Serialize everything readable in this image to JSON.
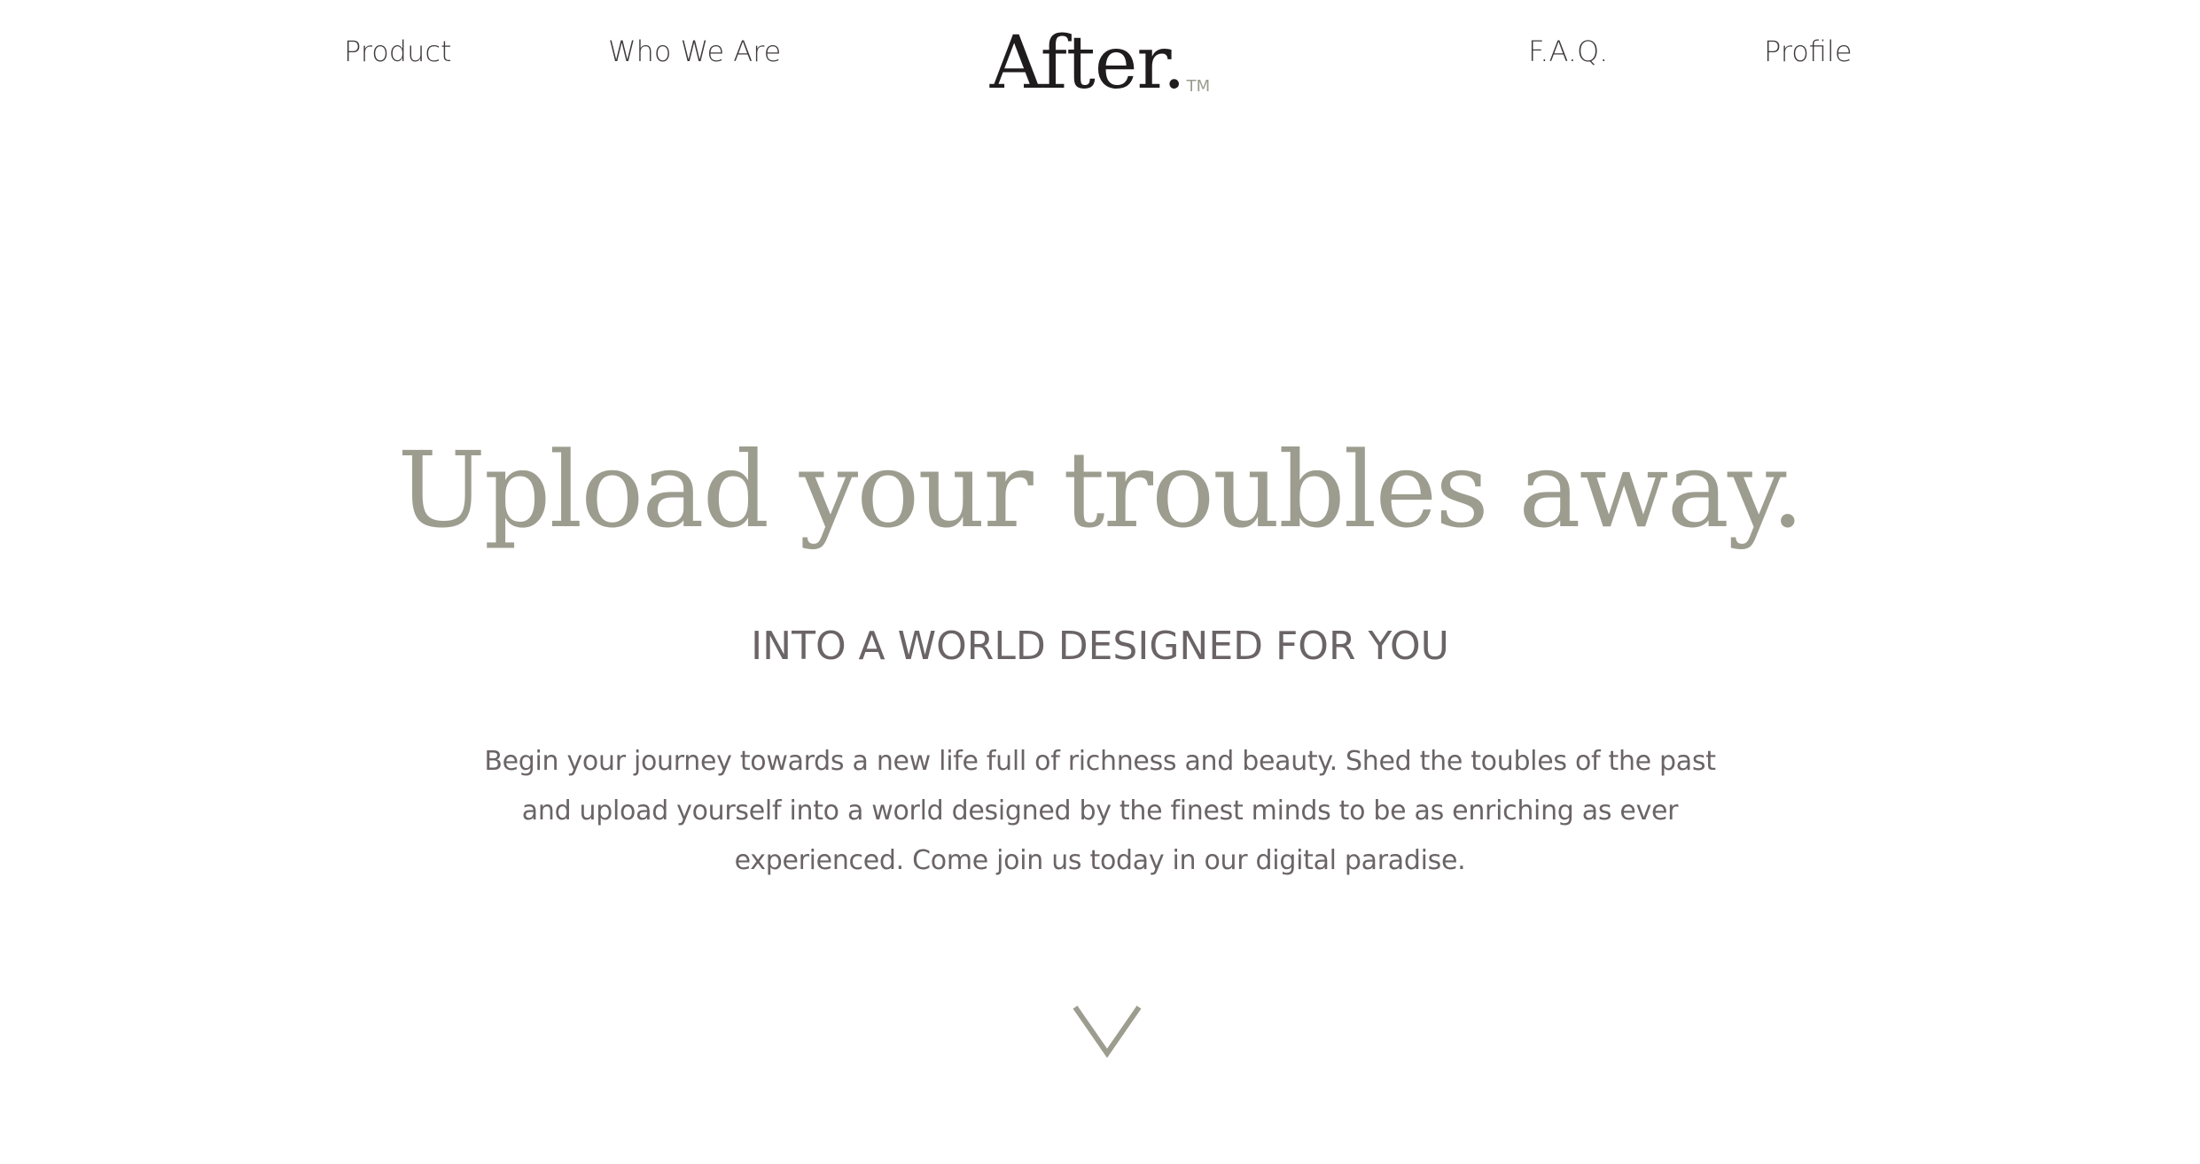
{
  "nav": {
    "left": [
      {
        "label": "Product"
      },
      {
        "label": "Who We Are"
      }
    ],
    "right": [
      {
        "label": "F.A.Q."
      },
      {
        "label": "Profile"
      }
    ]
  },
  "logo": {
    "text": "After.",
    "trademark": "TM"
  },
  "hero": {
    "title": "Upload your troubles away.",
    "subtitle": "INTO A WORLD DESIGNED FOR YOU",
    "body": "Begin your journey towards a new life full of richness and beauty. Shed the toubles of the past and upload yourself into a world designed by the finest minds to be as enriching as ever experienced. Come join us today in our digital paradise."
  },
  "scroll": {
    "icon": "chevron-down-icon"
  },
  "colors": {
    "background": "#ffffff",
    "nav_text": "#3f3a3c",
    "logo": "#1f1c1d",
    "accent_sage": "#9c9d8f",
    "body_text": "#6b6466"
  }
}
